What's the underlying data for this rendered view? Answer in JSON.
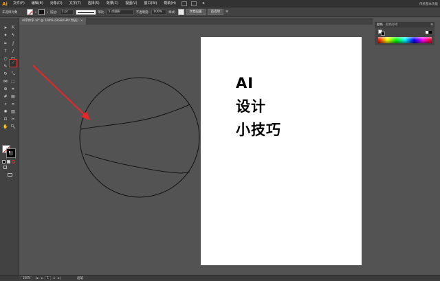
{
  "app": {
    "logo": "Ai"
  },
  "menu": {
    "items": [
      "文件(F)",
      "编辑(E)",
      "对象(O)",
      "文字(T)",
      "选择(S)",
      "效果(C)",
      "视图(V)",
      "窗口(W)",
      "帮助(H)"
    ],
    "workspace": "传统基本功能"
  },
  "control_bar": {
    "selection_label": "未选择对象",
    "stroke_label": "描边:",
    "stroke_weight": "1 pt",
    "stroke_style_label": "等比",
    "brush_size": "5 点圆形",
    "opacity_label": "不透明度:",
    "opacity_value": "100%",
    "style_label": "样式:",
    "doc_setup_button": "文档设置",
    "prefs_button": "首选项"
  },
  "document_tab": {
    "title": "AI字体字.ai* @ 100% (RGB/GPU 预览)",
    "close": "×"
  },
  "color_panel": {
    "tab_color": "颜色",
    "tab_color_guide": "颜色参考"
  },
  "artboard": {
    "lines": [
      "AI",
      "设计",
      "小技巧"
    ]
  },
  "status_bar": {
    "zoom": "100%",
    "page": "1",
    "tool_name": "画笔"
  },
  "colors": {
    "accent_red": "#e53333",
    "arrow_red": "#e8262a"
  }
}
